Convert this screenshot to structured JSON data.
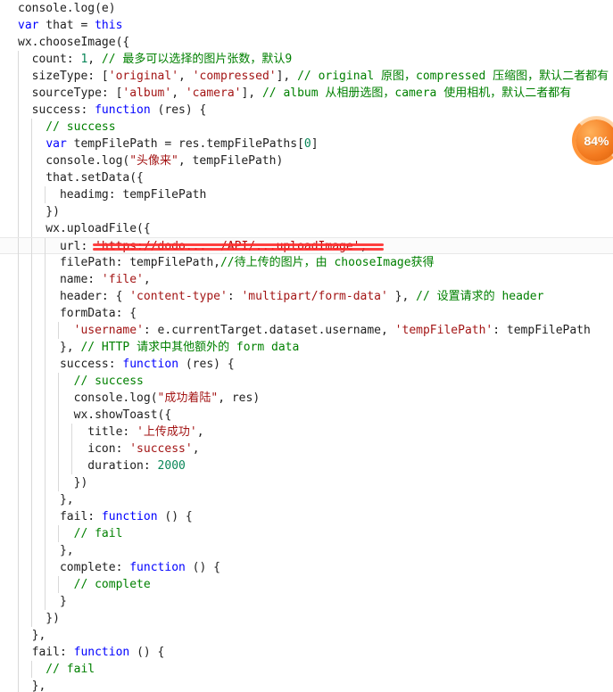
{
  "editor": {
    "language": "JavaScript",
    "lines": [
      {
        "highlighted": false,
        "tokens": [
          {
            "text": "console.log(e)",
            "type": "plain"
          }
        ]
      },
      {
        "highlighted": false,
        "tokens": [
          {
            "text": "var",
            "type": "keyword"
          },
          {
            "text": " that = ",
            "type": "plain"
          },
          {
            "text": "this",
            "type": "keyword"
          }
        ]
      },
      {
        "highlighted": false,
        "tokens": [
          {
            "text": "wx.chooseImage({",
            "type": "plain"
          }
        ]
      },
      {
        "highlighted": false,
        "tokens": [
          {
            "text": "  count: ",
            "type": "plain"
          },
          {
            "text": "1",
            "type": "number"
          },
          {
            "text": ", ",
            "type": "plain"
          },
          {
            "text": "// 最多可以选择的图片张数，默认9",
            "type": "comment"
          }
        ]
      },
      {
        "highlighted": false,
        "tokens": [
          {
            "text": "  sizeType: [",
            "type": "plain"
          },
          {
            "text": "'original'",
            "type": "string"
          },
          {
            "text": ", ",
            "type": "plain"
          },
          {
            "text": "'compressed'",
            "type": "string"
          },
          {
            "text": "], ",
            "type": "plain"
          },
          {
            "text": "// original 原图，compressed 压缩图，默认二者都有",
            "type": "comment"
          }
        ]
      },
      {
        "highlighted": false,
        "tokens": [
          {
            "text": "  sourceType: [",
            "type": "plain"
          },
          {
            "text": "'album'",
            "type": "string"
          },
          {
            "text": ", ",
            "type": "plain"
          },
          {
            "text": "'camera'",
            "type": "string"
          },
          {
            "text": "], ",
            "type": "plain"
          },
          {
            "text": "// album 从相册选图，camera 使用相机，默认二者都有",
            "type": "comment"
          }
        ]
      },
      {
        "highlighted": false,
        "tokens": [
          {
            "text": "  success: ",
            "type": "plain"
          },
          {
            "text": "function",
            "type": "keyword"
          },
          {
            "text": " (res) {",
            "type": "plain"
          }
        ]
      },
      {
        "highlighted": false,
        "tokens": [
          {
            "text": "    // success",
            "type": "comment"
          }
        ]
      },
      {
        "highlighted": false,
        "tokens": [
          {
            "text": "    ",
            "type": "plain"
          },
          {
            "text": "var",
            "type": "keyword"
          },
          {
            "text": " tempFilePath = res.tempFilePaths[",
            "type": "plain"
          },
          {
            "text": "0",
            "type": "number"
          },
          {
            "text": "]",
            "type": "plain"
          }
        ]
      },
      {
        "highlighted": false,
        "tokens": [
          {
            "text": "    console.log(",
            "type": "plain"
          },
          {
            "text": "\"头像来\"",
            "type": "string"
          },
          {
            "text": ", tempFilePath)",
            "type": "plain"
          }
        ]
      },
      {
        "highlighted": false,
        "tokens": [
          {
            "text": "    that.setData({",
            "type": "plain"
          }
        ]
      },
      {
        "highlighted": false,
        "tokens": [
          {
            "text": "      headimg: tempFilePath",
            "type": "plain"
          }
        ]
      },
      {
        "highlighted": false,
        "tokens": [
          {
            "text": "    })",
            "type": "plain"
          }
        ]
      },
      {
        "highlighted": false,
        "tokens": [
          {
            "text": "    wx.uploadFile({",
            "type": "plain"
          }
        ]
      },
      {
        "highlighted": true,
        "tokens": [
          {
            "text": "      url: ",
            "type": "plain"
          },
          {
            "text": "'https://dodo...  /API/...uploadImage'",
            "type": "redacted"
          },
          {
            "text": ",",
            "type": "plain"
          }
        ]
      },
      {
        "highlighted": false,
        "tokens": [
          {
            "text": "      filePath: tempFilePath,",
            "type": "plain"
          },
          {
            "text": "//待上传的图片，由 chooseImage获得",
            "type": "comment"
          }
        ]
      },
      {
        "highlighted": false,
        "tokens": [
          {
            "text": "      name: ",
            "type": "plain"
          },
          {
            "text": "'file'",
            "type": "string"
          },
          {
            "text": ",",
            "type": "plain"
          }
        ]
      },
      {
        "highlighted": false,
        "tokens": [
          {
            "text": "      header: { ",
            "type": "plain"
          },
          {
            "text": "'content-type'",
            "type": "string"
          },
          {
            "text": ": ",
            "type": "plain"
          },
          {
            "text": "'multipart/form-data'",
            "type": "string"
          },
          {
            "text": " }, ",
            "type": "plain"
          },
          {
            "text": "// 设置请求的 header",
            "type": "comment"
          }
        ]
      },
      {
        "highlighted": false,
        "tokens": [
          {
            "text": "      formData: {",
            "type": "plain"
          }
        ]
      },
      {
        "highlighted": false,
        "tokens": [
          {
            "text": "        ",
            "type": "plain"
          },
          {
            "text": "'username'",
            "type": "string"
          },
          {
            "text": ": e.currentTarget.dataset.username, ",
            "type": "plain"
          },
          {
            "text": "'tempFilePath'",
            "type": "string"
          },
          {
            "text": ": tempFilePath",
            "type": "plain"
          }
        ]
      },
      {
        "highlighted": false,
        "tokens": [
          {
            "text": "      }, ",
            "type": "plain"
          },
          {
            "text": "// HTTP 请求中其他额外的 form data",
            "type": "comment"
          }
        ]
      },
      {
        "highlighted": false,
        "tokens": [
          {
            "text": "      success: ",
            "type": "plain"
          },
          {
            "text": "function",
            "type": "keyword"
          },
          {
            "text": " (res) {",
            "type": "plain"
          }
        ]
      },
      {
        "highlighted": false,
        "tokens": [
          {
            "text": "        // success",
            "type": "comment"
          }
        ]
      },
      {
        "highlighted": false,
        "tokens": [
          {
            "text": "        console.log(",
            "type": "plain"
          },
          {
            "text": "\"成功着陆\"",
            "type": "string"
          },
          {
            "text": ", res)",
            "type": "plain"
          }
        ]
      },
      {
        "highlighted": false,
        "tokens": [
          {
            "text": "        wx.showToast({",
            "type": "plain"
          }
        ]
      },
      {
        "highlighted": false,
        "tokens": [
          {
            "text": "          title: ",
            "type": "plain"
          },
          {
            "text": "'上传成功'",
            "type": "string"
          },
          {
            "text": ",",
            "type": "plain"
          }
        ]
      },
      {
        "highlighted": false,
        "tokens": [
          {
            "text": "          icon: ",
            "type": "plain"
          },
          {
            "text": "'success'",
            "type": "string"
          },
          {
            "text": ",",
            "type": "plain"
          }
        ]
      },
      {
        "highlighted": false,
        "tokens": [
          {
            "text": "          duration: ",
            "type": "plain"
          },
          {
            "text": "2000",
            "type": "number"
          }
        ]
      },
      {
        "highlighted": false,
        "tokens": [
          {
            "text": "        })",
            "type": "plain"
          }
        ]
      },
      {
        "highlighted": false,
        "tokens": [
          {
            "text": "      },",
            "type": "plain"
          }
        ]
      },
      {
        "highlighted": false,
        "tokens": [
          {
            "text": "      fail: ",
            "type": "plain"
          },
          {
            "text": "function",
            "type": "keyword"
          },
          {
            "text": " () {",
            "type": "plain"
          }
        ]
      },
      {
        "highlighted": false,
        "tokens": [
          {
            "text": "        // fail",
            "type": "comment"
          }
        ]
      },
      {
        "highlighted": false,
        "tokens": [
          {
            "text": "      },",
            "type": "plain"
          }
        ]
      },
      {
        "highlighted": false,
        "tokens": [
          {
            "text": "      complete: ",
            "type": "plain"
          },
          {
            "text": "function",
            "type": "keyword"
          },
          {
            "text": " () {",
            "type": "plain"
          }
        ]
      },
      {
        "highlighted": false,
        "tokens": [
          {
            "text": "        // complete",
            "type": "comment"
          }
        ]
      },
      {
        "highlighted": false,
        "tokens": [
          {
            "text": "      }",
            "type": "plain"
          }
        ]
      },
      {
        "highlighted": false,
        "tokens": [
          {
            "text": "    })",
            "type": "plain"
          }
        ]
      },
      {
        "highlighted": false,
        "tokens": [
          {
            "text": "  },",
            "type": "plain"
          }
        ]
      },
      {
        "highlighted": false,
        "tokens": [
          {
            "text": "  fail: ",
            "type": "plain"
          },
          {
            "text": "function",
            "type": "keyword"
          },
          {
            "text": " () {",
            "type": "plain"
          }
        ]
      },
      {
        "highlighted": false,
        "tokens": [
          {
            "text": "    // fail",
            "type": "comment"
          }
        ]
      },
      {
        "highlighted": false,
        "tokens": [
          {
            "text": "  },",
            "type": "plain"
          }
        ]
      }
    ]
  },
  "overlay": {
    "progress_percent": 84,
    "progress_label": "84%",
    "accent_color": "#f47b20"
  },
  "colors": {
    "keyword": "#0000ff",
    "string": "#a31515",
    "comment": "#008000",
    "number": "#098658",
    "plain": "#202020",
    "redaction_mark": "#ff2a2a"
  }
}
